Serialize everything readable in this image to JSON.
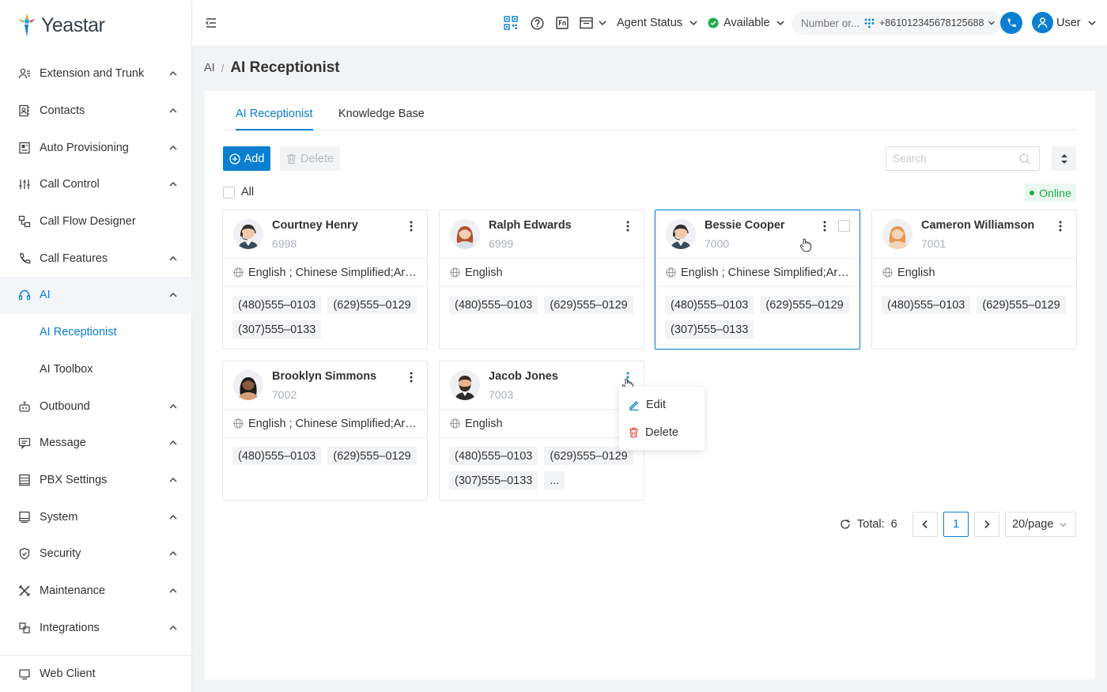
{
  "brand": {
    "name": "Yeastar"
  },
  "sidebar": {
    "items": [
      {
        "label": "Extension and Trunk",
        "icon": "users-icon",
        "expandable": true
      },
      {
        "label": "Contacts",
        "icon": "contacts-icon",
        "expandable": true
      },
      {
        "label": "Auto Provisioning",
        "icon": "provisioning-icon",
        "expandable": true
      },
      {
        "label": "Call Control",
        "icon": "sliders-icon",
        "expandable": true
      },
      {
        "label": "Call Flow Designer",
        "icon": "flow-icon",
        "expandable": false
      },
      {
        "label": "Call Features",
        "icon": "phone-icon",
        "expandable": true
      },
      {
        "label": "AI",
        "icon": "headset-icon",
        "expandable": true,
        "active": true
      },
      {
        "label": "AI Receptionist",
        "sub": true,
        "active": true
      },
      {
        "label": "AI Toolbox",
        "sub": true
      },
      {
        "label": "Outbound",
        "icon": "robot-icon",
        "expandable": true
      },
      {
        "label": "Message",
        "icon": "message-icon",
        "expandable": true
      },
      {
        "label": "PBX Settings",
        "icon": "server-icon",
        "expandable": true
      },
      {
        "label": "System",
        "icon": "monitor-icon",
        "expandable": true
      },
      {
        "label": "Security",
        "icon": "shield-icon",
        "expandable": true
      },
      {
        "label": "Maintenance",
        "icon": "tools-icon",
        "expandable": true
      },
      {
        "label": "Integrations",
        "icon": "integrations-icon",
        "expandable": true
      }
    ],
    "web_client": "Web Client"
  },
  "header": {
    "agent_status": "Agent Status",
    "presence": "Available",
    "number_placeholder": "Number or...",
    "phone_number": "+861012345678125688",
    "user": "User"
  },
  "breadcrumb": {
    "parent": "AI",
    "separator": "/",
    "title": "AI Receptionist"
  },
  "tabs": [
    {
      "label": "AI Receptionist",
      "active": true
    },
    {
      "label": "Knowledge Base",
      "active": false
    }
  ],
  "toolbar": {
    "add_label": "Add",
    "delete_label": "Delete",
    "search_placeholder": "Search",
    "select_all_label": "All",
    "online_label": "Online"
  },
  "cards": [
    {
      "name": "Courtney Henry",
      "ext": "6998",
      "languages": "English ; Chinese Simplified;Arabic",
      "numbers": [
        "(480)555–0103",
        "(629)555–0129",
        "(307)555–0133"
      ],
      "avatar": "male"
    },
    {
      "name": "Ralph Edwards",
      "ext": "6999",
      "languages": "English",
      "numbers": [
        "(480)555–0103",
        "(629)555–0129"
      ],
      "avatar": "female"
    },
    {
      "name": "Bessie Cooper",
      "ext": "7000",
      "languages": "English ; Chinese Simplified;Arabic",
      "numbers": [
        "(480)555–0103",
        "(629)555–0129",
        "(307)555–0133"
      ],
      "avatar": "male",
      "selected": true
    },
    {
      "name": "Cameron Williamson",
      "ext": "7001",
      "languages": "English",
      "numbers": [
        "(480)555–0103",
        "(629)555–0129"
      ],
      "avatar": "female-blonde"
    },
    {
      "name": "Brooklyn Simmons",
      "ext": "7002",
      "languages": "English ; Chinese Simplified;Arabic",
      "numbers": [
        "(480)555–0103",
        "(629)555–0129"
      ],
      "avatar": "female-dark"
    },
    {
      "name": "Jacob Jones",
      "ext": "7003",
      "languages": "English",
      "numbers": [
        "(480)555–0103",
        "(629)555–0129",
        "(307)555–0133",
        "..."
      ],
      "avatar": "male-beard"
    }
  ],
  "context_menu": {
    "edit": "Edit",
    "delete": "Delete"
  },
  "pagination": {
    "total_label": "Total:",
    "total": "6",
    "current_page": "1",
    "page_size": "20/page"
  },
  "colors": {
    "accent": "#0a7fd1",
    "online": "#1aad4b",
    "danger": "#e5483d"
  }
}
